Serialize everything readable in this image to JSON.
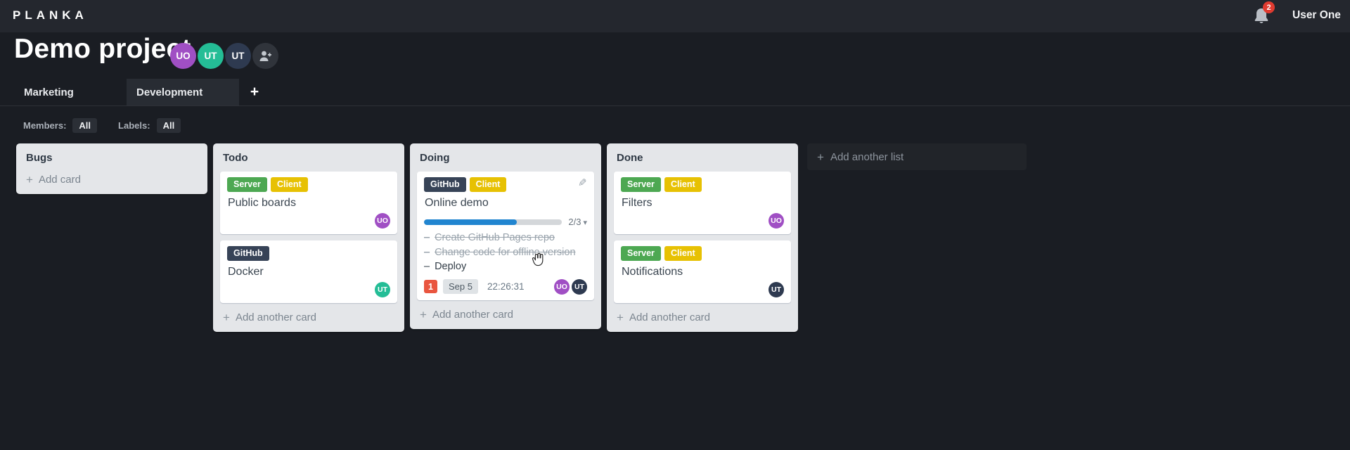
{
  "colors": {
    "topbar_bg": "#24272e",
    "page_bg": "#1a1d23",
    "list_bg": "#e4e6e9",
    "card_bg": "#ffffff",
    "label_green": "#4da852",
    "label_yellow": "#e7c103",
    "label_navy": "#374357",
    "avatar_purple": "#a04fc4",
    "avatar_teal": "#24bd96",
    "avatar_navy": "#2e3a50",
    "progress_blue": "#2185d0",
    "notification_red": "#e03b30",
    "card_badge_red": "#e9553f"
  },
  "icons": {
    "plus": "+",
    "edit": "✎",
    "caret_down": "▾",
    "dash": "–"
  },
  "header": {
    "logo": "PLANKA",
    "notification_count": "2",
    "user_name": "User One"
  },
  "project": {
    "title": "Demo project",
    "members": [
      {
        "initials": "UO",
        "color": "#a04fc4"
      },
      {
        "initials": "UT",
        "color": "#24bd96"
      },
      {
        "initials": "UT",
        "color": "#2e3a50"
      }
    ]
  },
  "tabs": [
    {
      "label": "Marketing",
      "active": false
    },
    {
      "label": "Development",
      "active": true
    }
  ],
  "filters": {
    "members_label": "Members:",
    "members_value": "All",
    "labels_label": "Labels:",
    "labels_value": "All"
  },
  "board": {
    "add_list_label": "Add another list",
    "lists": [
      {
        "title": "Bugs",
        "add_label": "Add card",
        "cards": []
      },
      {
        "title": "Todo",
        "add_label": "Add another card",
        "cards": [
          {
            "title": "Public boards",
            "labels": [
              "Server",
              "Client"
            ],
            "avatars": [
              "UO"
            ]
          },
          {
            "title": "Docker",
            "labels": [
              "GitHub"
            ],
            "avatars": [
              "UT"
            ]
          }
        ]
      },
      {
        "title": "Doing",
        "add_label": "Add another card",
        "cards": [
          {
            "title": "Online demo",
            "labels": [
              "GitHub",
              "Client"
            ],
            "progress": {
              "value": 2,
              "total": 3,
              "label": "2/3",
              "percent": 67
            },
            "tasks": [
              {
                "text": "Create GitHub Pages repo",
                "done": true
              },
              {
                "text": "Change code for offline version",
                "done": true
              },
              {
                "text": "Deploy",
                "done": false
              }
            ],
            "notification_count": "1",
            "due_date": "Sep 5",
            "timer": "22:26:31",
            "avatars": [
              "UO",
              "UT"
            ]
          }
        ]
      },
      {
        "title": "Done",
        "add_label": "Add another card",
        "cards": [
          {
            "title": "Filters",
            "labels": [
              "Server",
              "Client"
            ],
            "avatars": [
              "UO"
            ]
          },
          {
            "title": "Notifications",
            "labels": [
              "Server",
              "Client"
            ],
            "avatars": [
              "UT"
            ]
          }
        ]
      }
    ]
  }
}
